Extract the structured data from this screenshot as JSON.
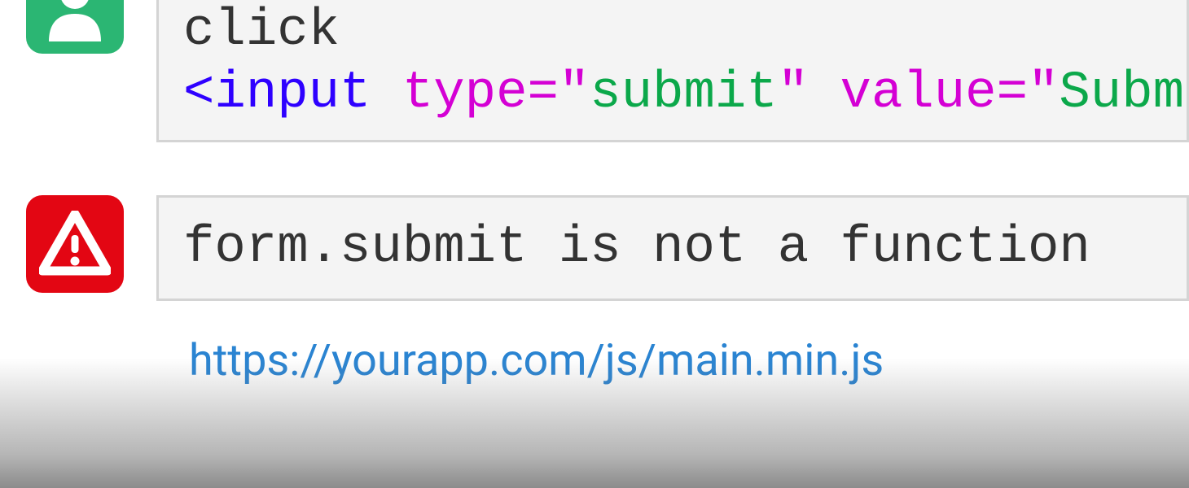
{
  "row1": {
    "line1": "click",
    "tag_open": "<input",
    "attr1_name": "type",
    "attr1_eq": "=",
    "attr1_q1": "\"",
    "attr1_val": "submit",
    "attr1_q2": "\"",
    "attr2_name": "value",
    "attr2_eq": "=",
    "attr2_q1": "\"",
    "attr2_val": "Submit"
  },
  "row2": {
    "message": "form.submit is not a function"
  },
  "url": "https://yourapp.com/js/main.min.js"
}
